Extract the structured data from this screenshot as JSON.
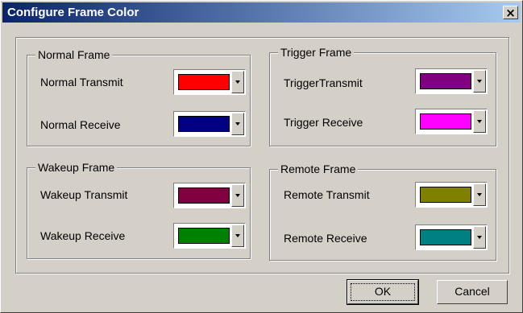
{
  "window": {
    "title": "Configure Frame Color",
    "close_label": "×"
  },
  "groups": {
    "normal": {
      "title": "Normal Frame",
      "transmit": {
        "label": "Normal Transmit",
        "color": "#ff0000"
      },
      "receive": {
        "label": "Normal Receive",
        "color": "#000080"
      }
    },
    "trigger": {
      "title": "Trigger Frame",
      "transmit": {
        "label": "TriggerTransmit",
        "color": "#800080"
      },
      "receive": {
        "label": "Trigger Receive",
        "color": "#ff00ff"
      }
    },
    "wakeup": {
      "title": "Wakeup Frame",
      "transmit": {
        "label": "Wakeup Transmit",
        "color": "#800040"
      },
      "receive": {
        "label": "Wakeup Receive",
        "color": "#008000"
      }
    },
    "remote": {
      "title": "Remote Frame",
      "transmit": {
        "label": "Remote Transmit",
        "color": "#808000"
      },
      "receive": {
        "label": "Remote Receive",
        "color": "#008080"
      }
    }
  },
  "buttons": {
    "ok": "OK",
    "cancel": "Cancel"
  }
}
